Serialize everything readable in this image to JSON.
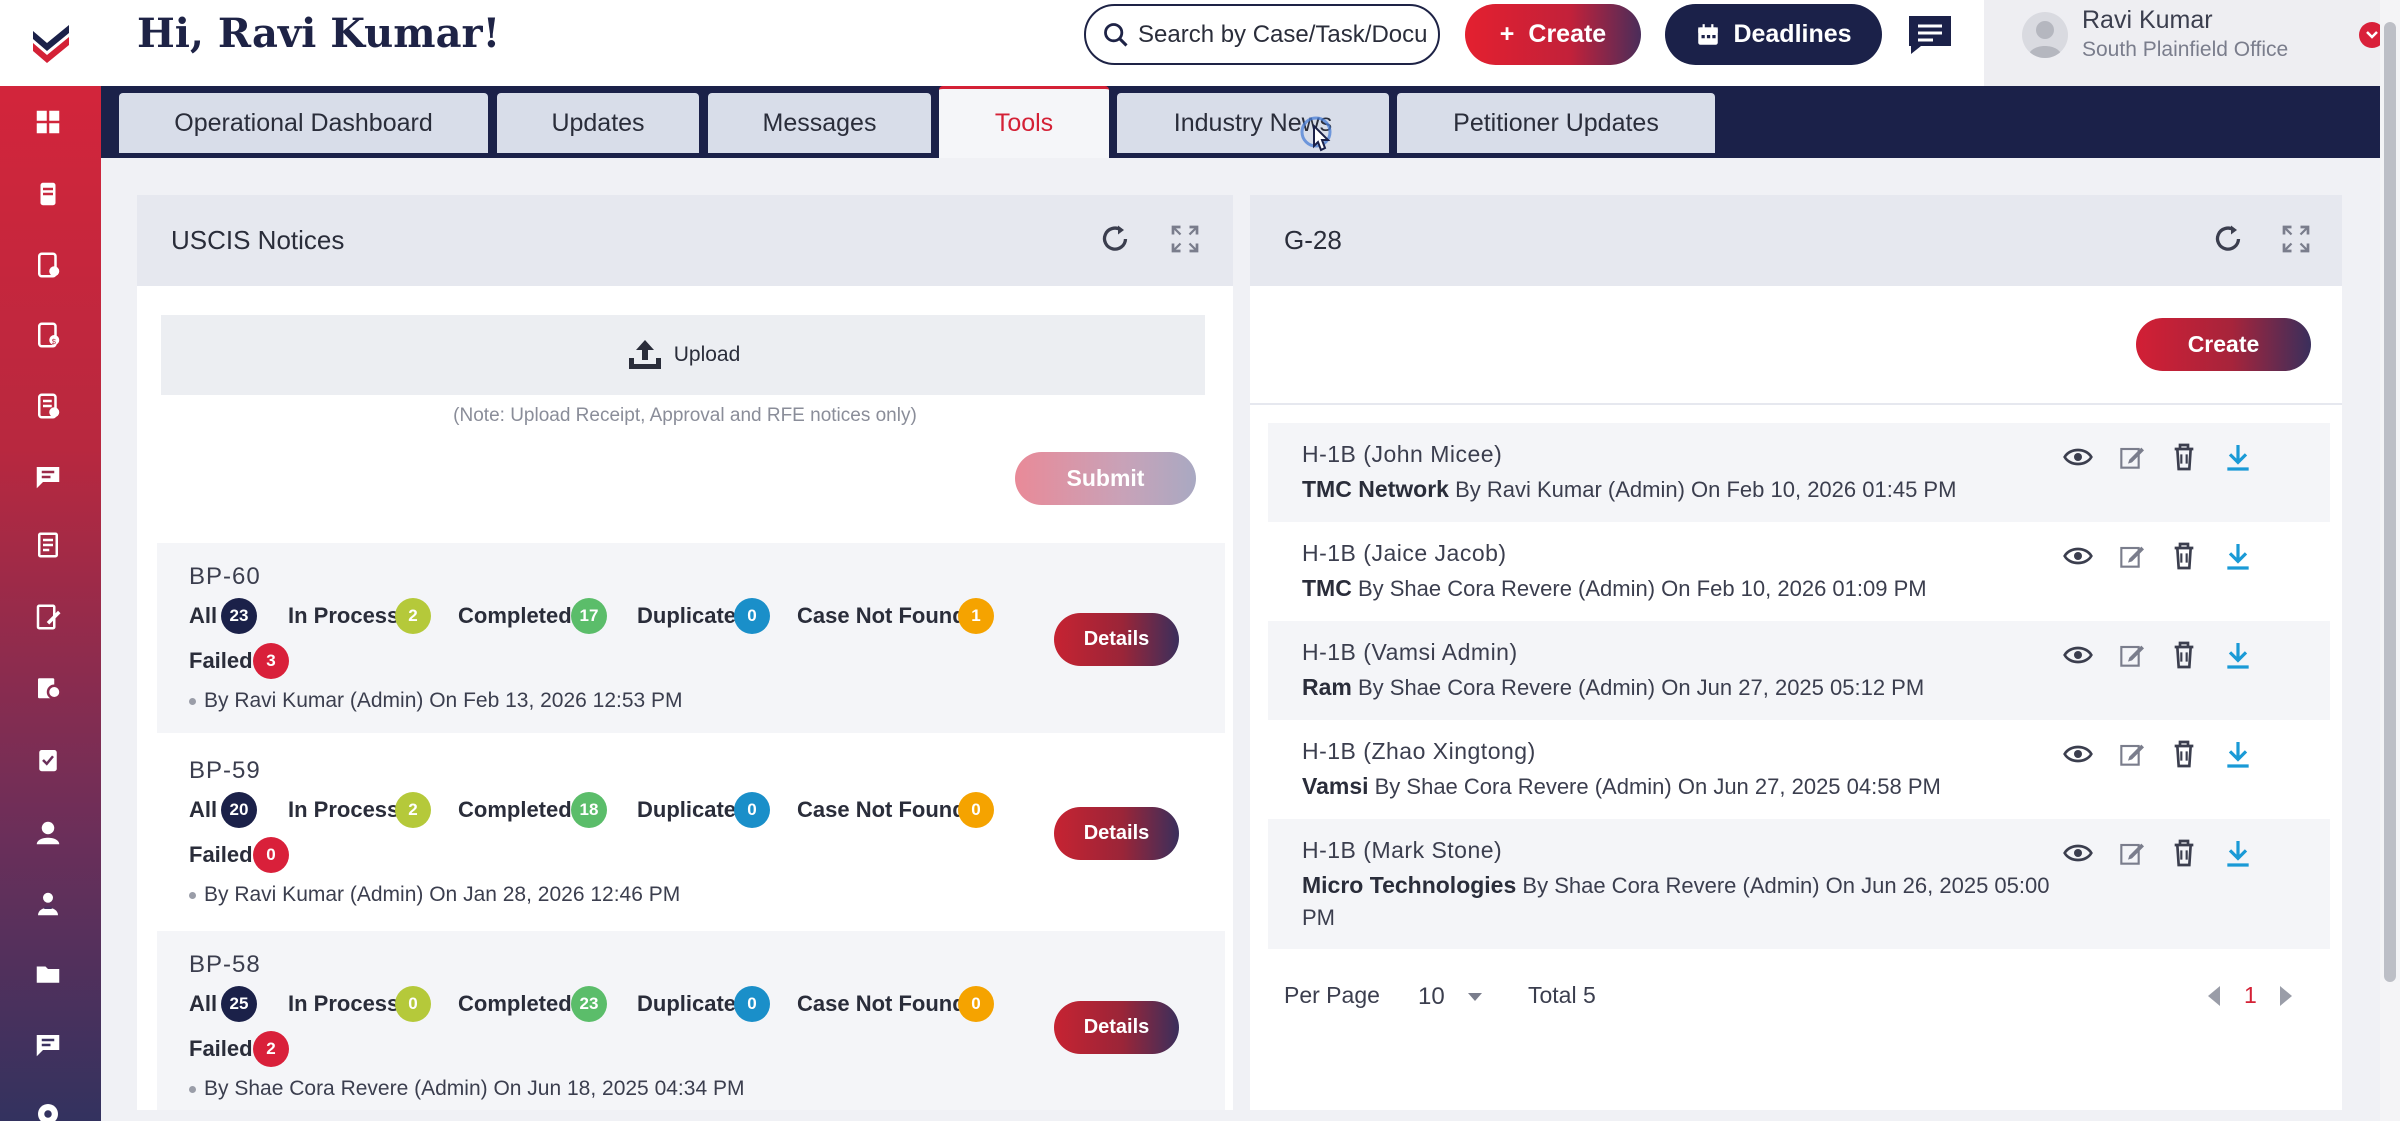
{
  "header": {
    "greeting": "Hi, Ravi Kumar!",
    "search_placeholder": "Search by Case/Task/Docu",
    "create_label": "Create",
    "deadlines_label": "Deadlines",
    "user_name": "Ravi Kumar",
    "user_office": "South Plainfield Office"
  },
  "sidebar": {
    "icons": [
      "dashboard-icon",
      "cases-icon",
      "tasks-icon",
      "invoices-icon",
      "forms-icon",
      "messages-icon",
      "documents-icon",
      "notes-icon",
      "reports-icon",
      "checklist-icon",
      "client-icon",
      "contacts-icon",
      "folder-icon",
      "chat-icon",
      "settings-icon"
    ]
  },
  "tabs": [
    {
      "label": "Operational Dashboard",
      "active": false
    },
    {
      "label": "Updates",
      "active": false
    },
    {
      "label": "Messages",
      "active": false
    },
    {
      "label": "Tools",
      "active": true
    },
    {
      "label": "Industry News",
      "active": false
    },
    {
      "label": "Petitioner Updates",
      "active": false
    }
  ],
  "uscis": {
    "title": "USCIS Notices",
    "upload_label": "Upload",
    "note": "(Note: Upload Receipt, Approval and RFE notices only)",
    "submit_label": "Submit",
    "labels": {
      "all": "All",
      "in_process": "In Process",
      "completed": "Completed",
      "duplicate": "Duplicate",
      "not_found": "Case Not Found",
      "failed": "Failed"
    },
    "details_label": "Details",
    "batches": [
      {
        "name": "BP-60",
        "all": "23",
        "in_process": "2",
        "completed": "17",
        "duplicate": "0",
        "not_found": "1",
        "failed": "3",
        "meta": "By Ravi Kumar (Admin) On Feb 13, 2026 12:53 PM"
      },
      {
        "name": "BP-59",
        "all": "20",
        "in_process": "2",
        "completed": "18",
        "duplicate": "0",
        "not_found": "0",
        "failed": "0",
        "meta": "By Ravi Kumar (Admin) On Jan 28, 2026 12:46 PM"
      },
      {
        "name": "BP-58",
        "all": "25",
        "in_process": "0",
        "completed": "23",
        "duplicate": "0",
        "not_found": "0",
        "failed": "2",
        "meta": "By Shae Cora Revere (Admin) On Jun 18, 2025 04:34 PM"
      }
    ]
  },
  "g28": {
    "title": "G-28",
    "create_label": "Create",
    "rows": [
      {
        "type": "H-1B",
        "person": "(John Micee)",
        "org": "TMC Network",
        "meta": "By Ravi Kumar (Admin) On Feb 10, 2026 01:45 PM"
      },
      {
        "type": "H-1B",
        "person": "(Jaice Jacob)",
        "org": "TMC",
        "meta": "By Shae Cora Revere (Admin) On Feb 10, 2026 01:09 PM"
      },
      {
        "type": "H-1B",
        "person": "(Vamsi Admin)",
        "org": "Ram",
        "meta": "By Shae Cora Revere (Admin) On Jun 27, 2025 05:12 PM"
      },
      {
        "type": "H-1B",
        "person": "(Zhao Xingtong)",
        "org": "Vamsi",
        "meta": "By Shae Cora Revere (Admin) On Jun 27, 2025 04:58 PM"
      },
      {
        "type": "H-1B",
        "person": "(Mark Stone)",
        "org": "Micro Technologies",
        "meta": "By Shae Cora Revere (Admin) On Jun 26, 2025 05:00 PM"
      }
    ],
    "per_page_label": "Per Page",
    "per_page_value": "10",
    "total_label": "Total 5",
    "page": "1"
  },
  "colors": {
    "brand_red": "#d42136",
    "navy": "#1b2149",
    "badge_navy": "#1b2149",
    "badge_lime": "#b5c93a",
    "badge_green": "#5bbd6a",
    "badge_blue": "#1a8fc9",
    "badge_orange": "#f5a300",
    "badge_red": "#d9203a"
  }
}
